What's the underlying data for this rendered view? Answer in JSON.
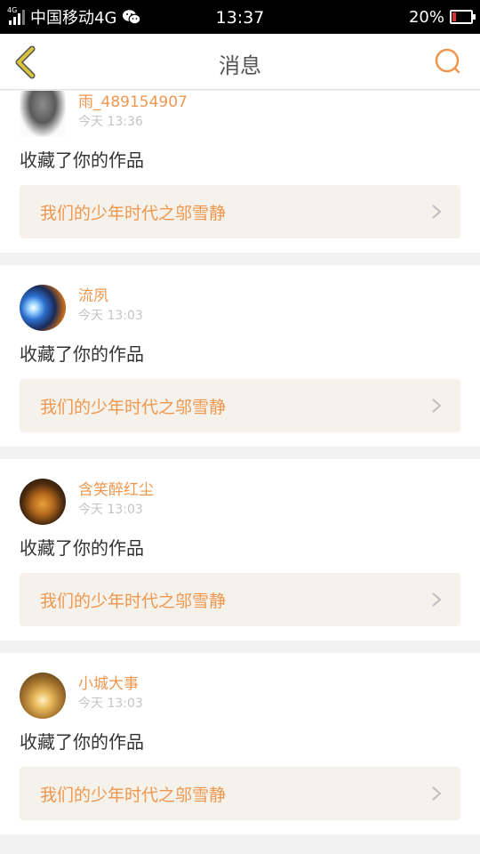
{
  "status_bar": {
    "network": "4G",
    "carrier": "中国移动4G",
    "time": "13:37",
    "battery": "20%",
    "battery_level": 0.2
  },
  "header": {
    "title": "消息"
  },
  "messages": [
    {
      "username": "雨_489154907",
      "time": "今天 13:36",
      "action": "收藏了你的作品",
      "work_title": "我们的少年时代之邬雪静"
    },
    {
      "username": "流夙",
      "time": "今天 13:03",
      "action": "收藏了你的作品",
      "work_title": "我们的少年时代之邬雪静"
    },
    {
      "username": "含笑醉红尘",
      "time": "今天 13:03",
      "action": "收藏了你的作品",
      "work_title": "我们的少年时代之邬雪静"
    },
    {
      "username": "小城大事",
      "time": "今天 13:03",
      "action": "收藏了你的作品",
      "work_title": "我们的少年时代之邬雪静"
    }
  ],
  "colors": {
    "accent": "#f0974f",
    "link_background": "#f4f2ea",
    "back_arrow": "#d9c43c"
  }
}
